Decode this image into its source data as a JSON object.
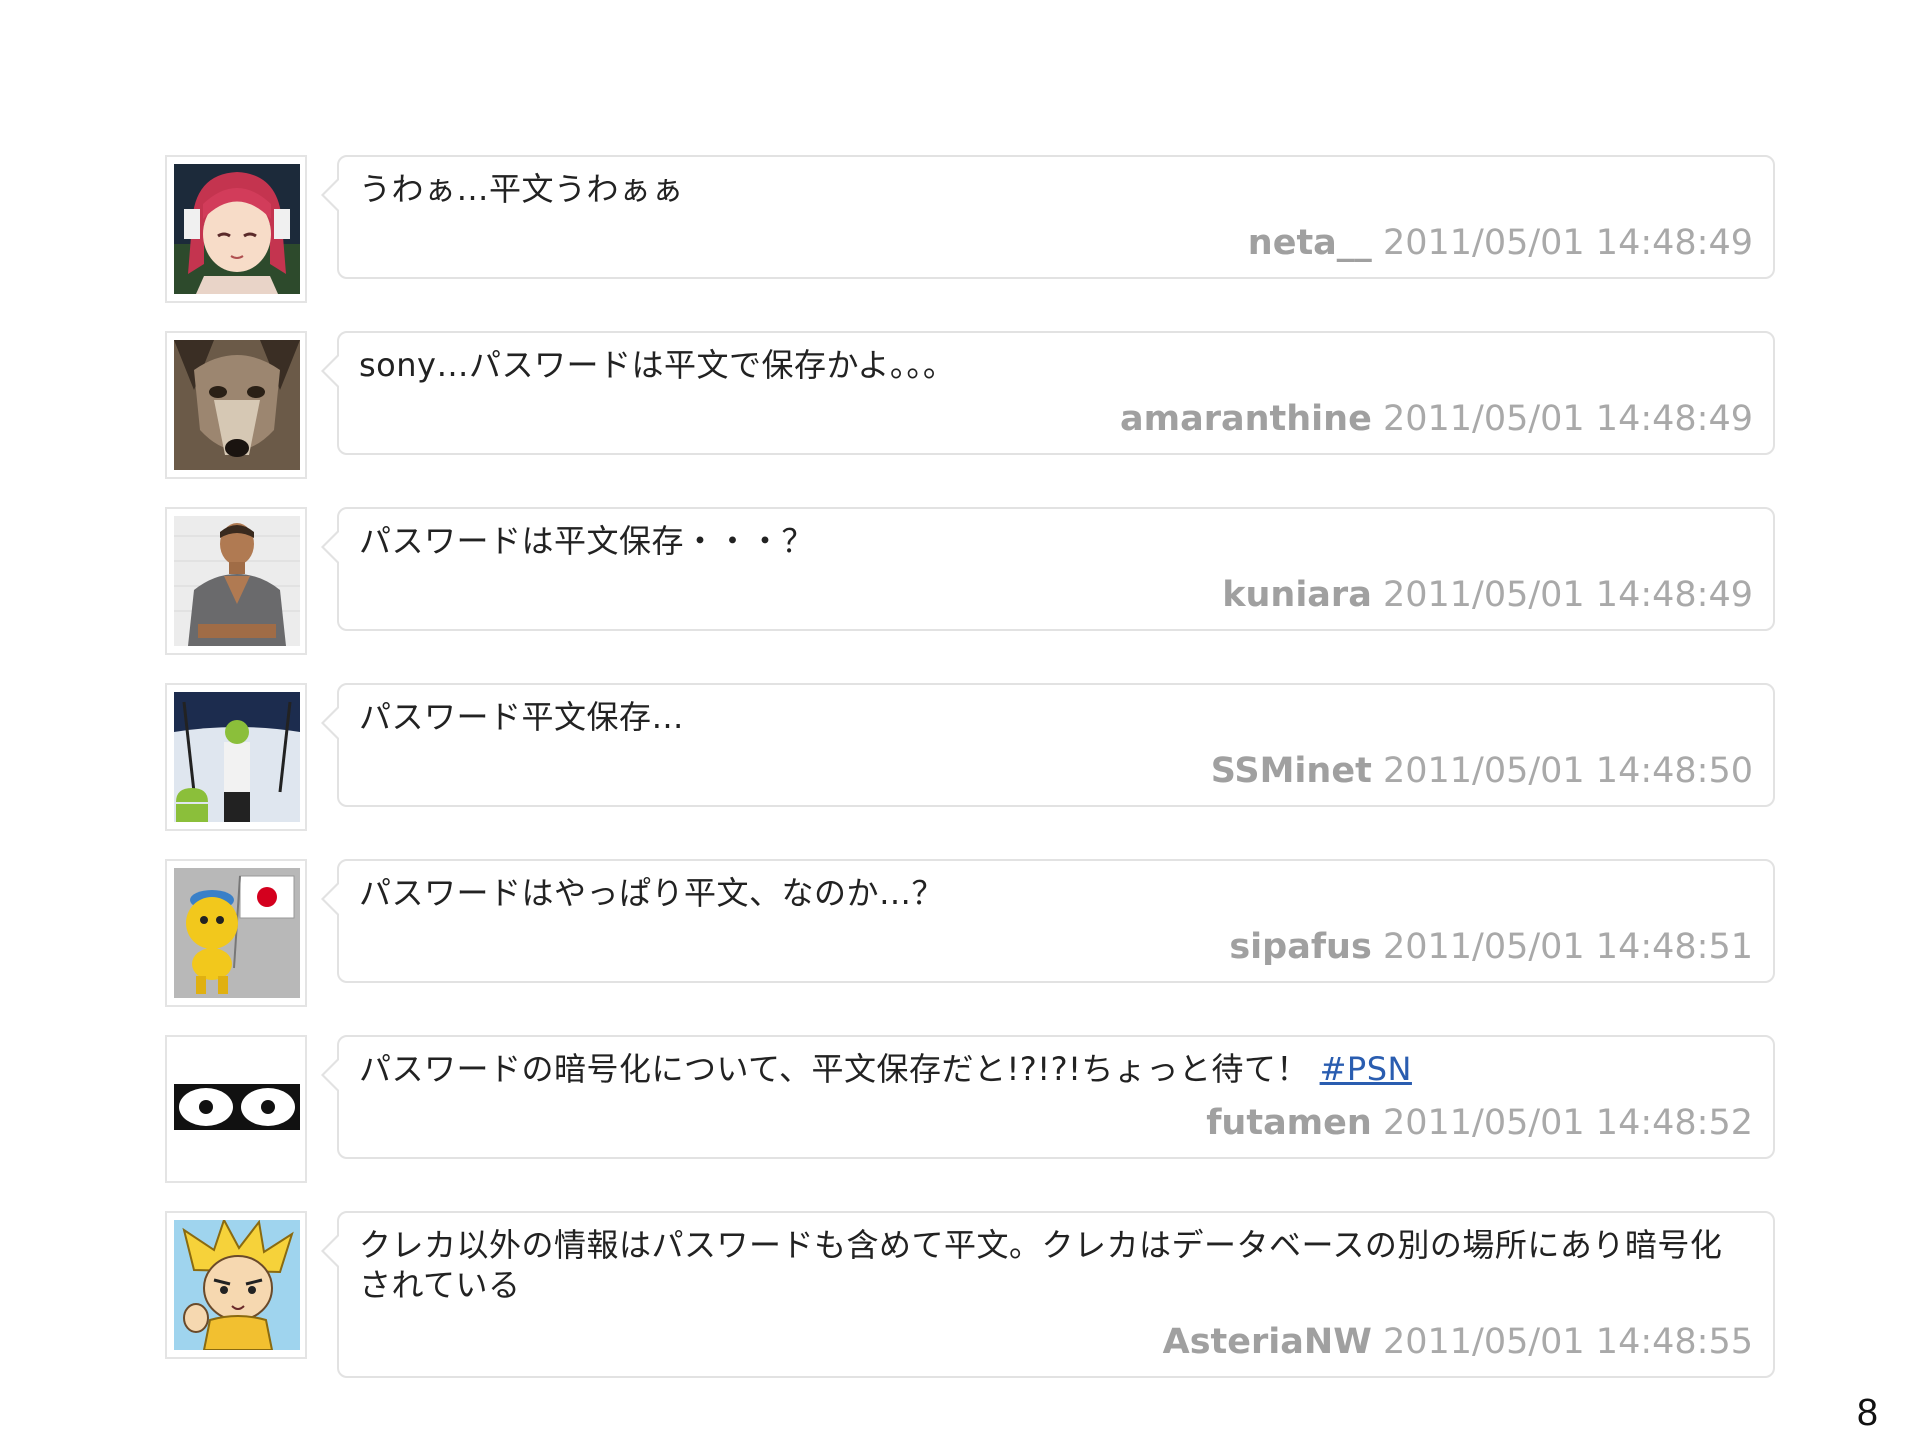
{
  "tweets": [
    {
      "text": "うわぁ…平文うわぁぁ",
      "user": "neta__",
      "time": "2011/05/01 14:48:49",
      "avatar": "anime-girl-avatar"
    },
    {
      "text": "sony…パスワードは平文で保存かよ。。。",
      "user": "amaranthine",
      "time": "2011/05/01 14:48:49",
      "avatar": "wolf-avatar"
    },
    {
      "text": "パスワードは平文保存・・・？",
      "user": "kuniara",
      "time": "2011/05/01 14:48:49",
      "avatar": "man-photo-avatar"
    },
    {
      "text": "パスワード平文保存…",
      "user": "SSMinet",
      "time": "2011/05/01 14:48:50",
      "avatar": "android-figure-avatar"
    },
    {
      "text": "パスワードはやっぱり平文、なのか…？",
      "user": "sipafus",
      "time": "2011/05/01 14:48:51",
      "avatar": "yellow-mascot-flag-avatar"
    },
    {
      "text": "パスワードの暗号化について、平文保存だと!?!?!ちょっと待て！",
      "hashtag": "#PSN",
      "user": "futamen",
      "time": "2011/05/01 14:48:52",
      "avatar": "eyes-avatar"
    },
    {
      "text": "クレカ以外の情報はパスワードも含めて平文。クレカはデータベースの別の場所にあり暗号化されている",
      "user": "AsteriaNW",
      "time": "2011/05/01 14:48:55",
      "avatar": "cartoon-blonde-avatar"
    }
  ],
  "page_number": "8"
}
